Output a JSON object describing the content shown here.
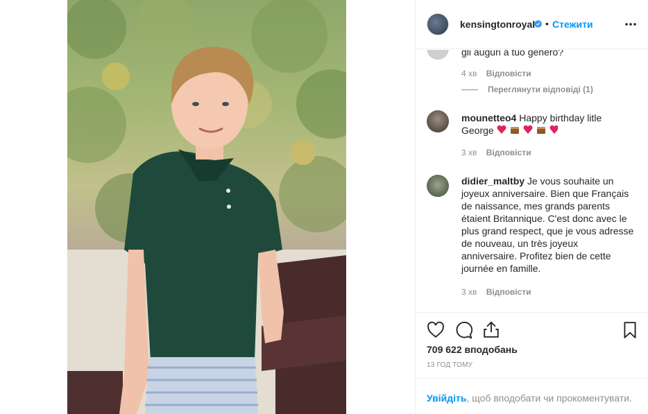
{
  "post": {
    "photo_alt": "Boy in green polo shirt smiling outdoors"
  },
  "header": {
    "username": "kensingtonroyal",
    "separator": "•",
    "follow_label": "Стежити"
  },
  "comments": [
    {
      "text": "gli auguri a tuo genero?",
      "time": "4 хв",
      "reply_label": "Відповісти",
      "view_replies": "Переглянути відповіді (1)"
    },
    {
      "username": "mounetteo4",
      "text": " Happy birthday litle George",
      "time": "3 хв",
      "reply_label": "Відповісти"
    },
    {
      "username": "didier_maltby",
      "text": " Je vous souhaite un joyeux anniversaire. Bien que Français de naissance, mes grands parents étaient Britannique. C'est donc avec le plus grand respect, que je vous adresse de nouveau, un très joyeux anniversaire. Profitez bien de cette journée en famille.",
      "time": "3 хв",
      "reply_label": "Відповісти"
    }
  ],
  "actions": {
    "likes": "709 622 вподобань",
    "time_ago": "13 ГОД ТОМУ"
  },
  "login_bar": {
    "login_label": "Увійдіть",
    "rest": ", щоб вподобати чи прокоментувати."
  },
  "colors": {
    "accent": "#0095f6",
    "muted": "#8e8e8e",
    "text": "#262626",
    "border": "#efefef"
  },
  "icons": [
    "verified-badge-icon",
    "more-options-icon",
    "heart-icon",
    "comment-icon",
    "share-icon",
    "bookmark-icon"
  ]
}
